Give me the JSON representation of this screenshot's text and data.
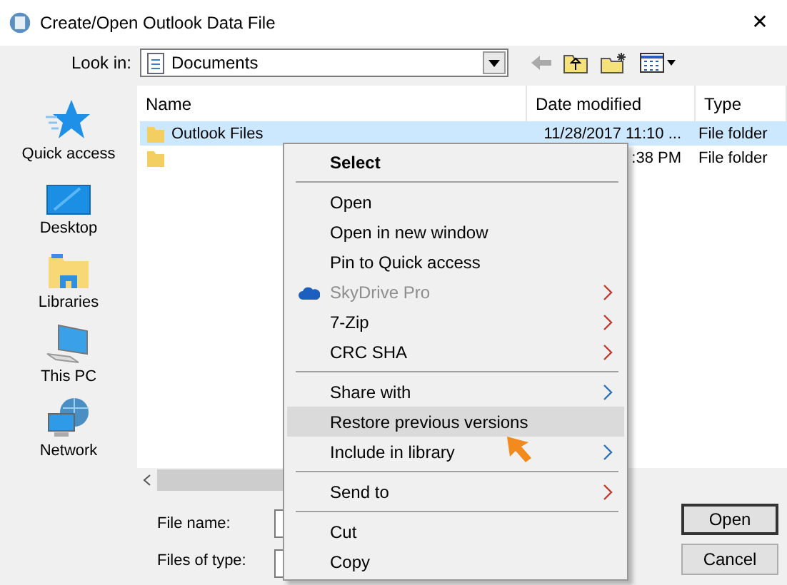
{
  "window": {
    "title": "Create/Open Outlook Data File",
    "close": "✕"
  },
  "look_in": {
    "label": "Look in:",
    "value": "Documents"
  },
  "places": [
    {
      "label": "Quick access",
      "kind": "star"
    },
    {
      "label": "Desktop",
      "kind": "desktop"
    },
    {
      "label": "Libraries",
      "kind": "library"
    },
    {
      "label": "This PC",
      "kind": "pc"
    },
    {
      "label": "Network",
      "kind": "network"
    }
  ],
  "columns": [
    "Name",
    "Date modified",
    "Type"
  ],
  "rows": [
    {
      "name": "Outlook Files",
      "date": "11/28/2017 11:10 ...",
      "type": "File folder",
      "selected": true
    },
    {
      "name": "",
      "date": ":38 PM",
      "type": "File folder",
      "selected": false
    }
  ],
  "file_name": {
    "label": "File name:"
  },
  "file_type": {
    "label": "Files of type:"
  },
  "buttons": [
    {
      "label": "Open",
      "default": true
    },
    {
      "label": "Cancel",
      "default": false
    }
  ],
  "context_menu": [
    {
      "kind": "item",
      "label": "Select",
      "bold": true,
      "highlighted": false
    },
    {
      "kind": "separator"
    },
    {
      "kind": "item",
      "label": "Open",
      "highlighted": false
    },
    {
      "kind": "item",
      "label": "Open in new window",
      "highlighted": false
    },
    {
      "kind": "item",
      "label": "Pin to Quick access",
      "highlighted": false
    },
    {
      "kind": "cloud_item",
      "label": "SkyDrive Pro",
      "disabled": true,
      "submenu": true,
      "color": "#c0392b",
      "highlighted": false
    },
    {
      "kind": "item",
      "label": "7-Zip",
      "submenu": true,
      "color": "#c0392b",
      "highlighted": false
    },
    {
      "kind": "item",
      "label": "CRC SHA",
      "submenu": true,
      "color": "#c0392b",
      "highlighted": false
    },
    {
      "kind": "separator"
    },
    {
      "kind": "item",
      "label": "Share with",
      "submenu": true,
      "color": "#2a6fb8",
      "highlighted": false
    },
    {
      "kind": "item",
      "label": "Restore previous versions",
      "highlighted": true
    },
    {
      "kind": "item",
      "label": "Include in library",
      "submenu": true,
      "color": "#2a6fb8",
      "highlighted": false
    },
    {
      "kind": "separator"
    },
    {
      "kind": "item",
      "label": "Send to",
      "submenu": true,
      "color": "#c0392b",
      "highlighted": false
    },
    {
      "kind": "separator"
    },
    {
      "kind": "item",
      "label": "Cut",
      "highlighted": false
    },
    {
      "kind": "item",
      "label": "Copy",
      "highlighted": false
    }
  ]
}
